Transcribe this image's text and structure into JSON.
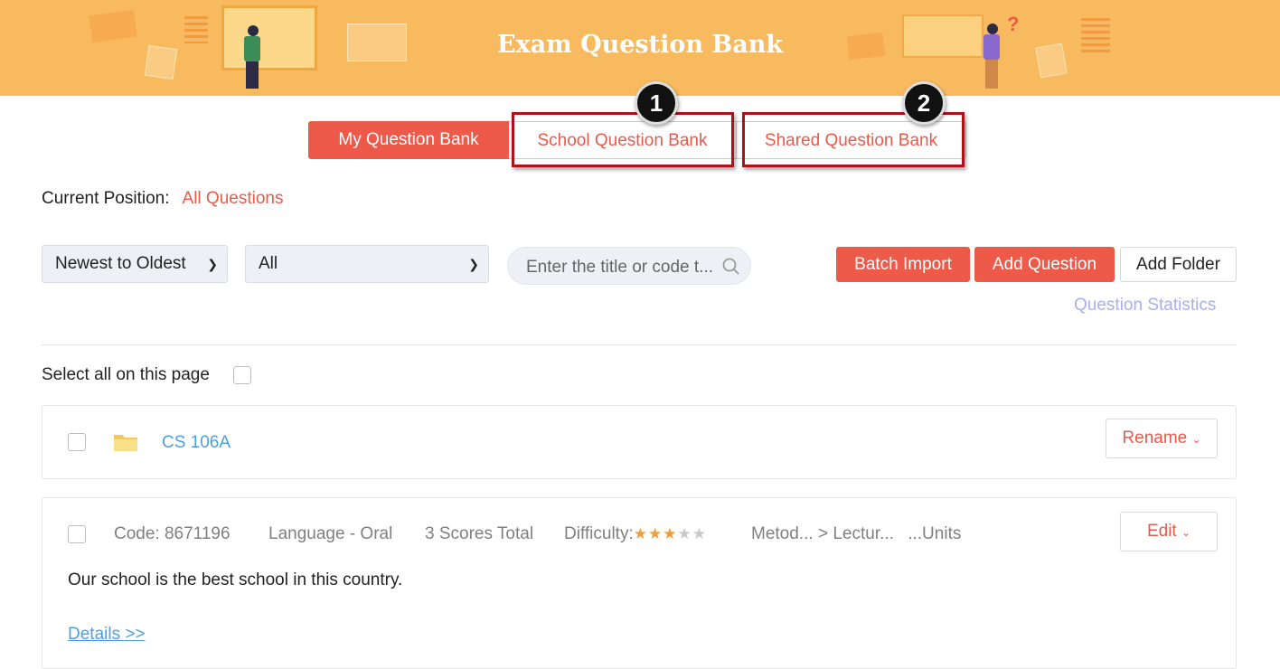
{
  "banner": {
    "title": "Exam Question Bank"
  },
  "tabs": {
    "mine": "My Question Bank",
    "school": "School Question Bank",
    "shared": "Shared Question Bank"
  },
  "callouts": {
    "one": "1",
    "two": "2"
  },
  "position": {
    "label": "Current Position:",
    "value": "All Questions"
  },
  "filters": {
    "sort": "Newest to Oldest",
    "type": "All",
    "search_placeholder": "Enter the title or code t..."
  },
  "buttons": {
    "batch_import": "Batch Import",
    "add_question": "Add Question",
    "add_folder": "Add Folder",
    "question_statistics": "Question Statistics"
  },
  "select_all": "Select all on this page",
  "folder": {
    "name": "CS 106A",
    "action": "Rename"
  },
  "question": {
    "code": "Code: 8671196",
    "type": "Language - Oral",
    "score": "3 Scores Total",
    "difficulty_label": "Difficulty:",
    "difficulty": 3,
    "difficulty_max": 5,
    "path_a": "Metod...",
    "separator": ">",
    "path_b": "Lectur...",
    "path_c": "...Units",
    "text": "Our school is the best school in this country.",
    "details": "Details >>",
    "action": "Edit"
  },
  "colors": {
    "accent": "#ee5a4a",
    "banner": "#f8ba5f",
    "link": "#4da0e0",
    "highlight": "#b0101a"
  }
}
